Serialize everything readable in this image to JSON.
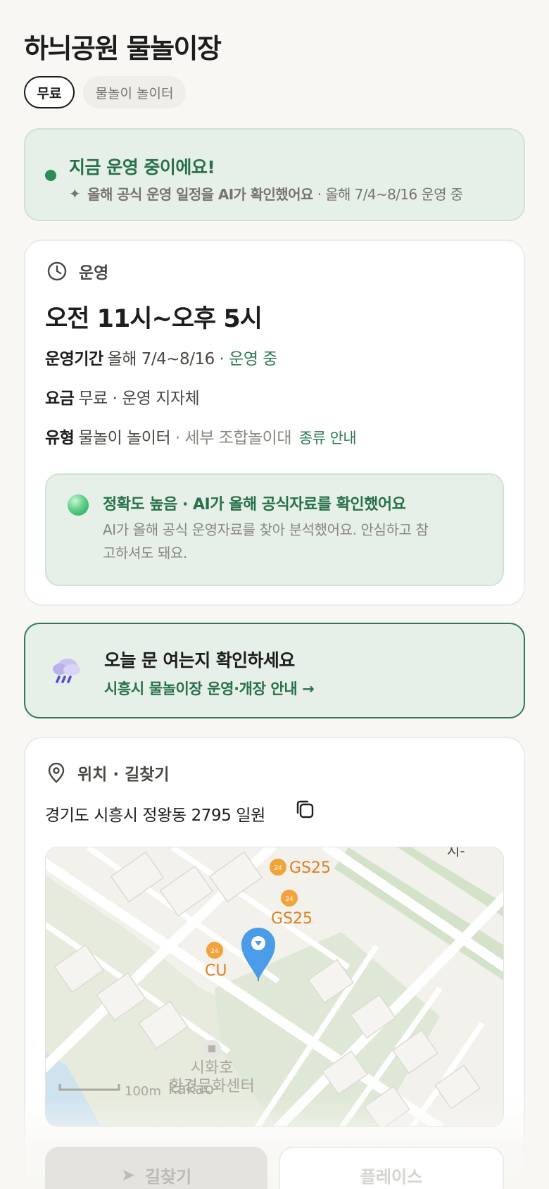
{
  "header": {
    "title": "하늬공원 물놀이장",
    "chips": [
      "무료",
      "물놀이 놀이터"
    ]
  },
  "status": {
    "title": "지금 운영 중이에요!",
    "ai_note": "올해 공식 운영 일정을 AI가 확인했어요",
    "period": "· 올해 7/4~8/16 운영 중"
  },
  "operation": {
    "heading": "운영",
    "hours": "오전 11시~오후 5시",
    "period_label": "운영기간",
    "period_value": "올해 7/4~8/16",
    "period_status": "· 운영 중",
    "fee_label": "요금",
    "fee_value": "무료 · 운영 지자체",
    "type_label": "유형",
    "type_value": "물놀이 놀이터",
    "type_detail": "· 세부 조합놀이대",
    "type_link": "종류 안내",
    "accuracy_title": "정확도 높음 · AI가 올해 공식자료를 확인했어요",
    "accuracy_body": "AI가 올해 공식 운영자료를 찾아 분석했어요. 안심하고 참고하셔도 돼요."
  },
  "cta": {
    "title": "오늘 문 여는지 확인하세요",
    "link": "시흥시 물놀이장 운영·개장 안내 →"
  },
  "location": {
    "heading": "위치 · 길찾기",
    "address": "경기도 시흥시 정왕동 2795 일원",
    "map": {
      "poi_gs25_a": "GS25",
      "poi_gs25_b": "GS25",
      "poi_cu": "CU",
      "poi_center_1": "시화호",
      "poi_center_2": "환경문화센터",
      "scale": "100m",
      "attribution": "kakao",
      "corner_text": "시-"
    }
  },
  "actions": {
    "navigate": "길찾기",
    "place": "플레이스"
  }
}
